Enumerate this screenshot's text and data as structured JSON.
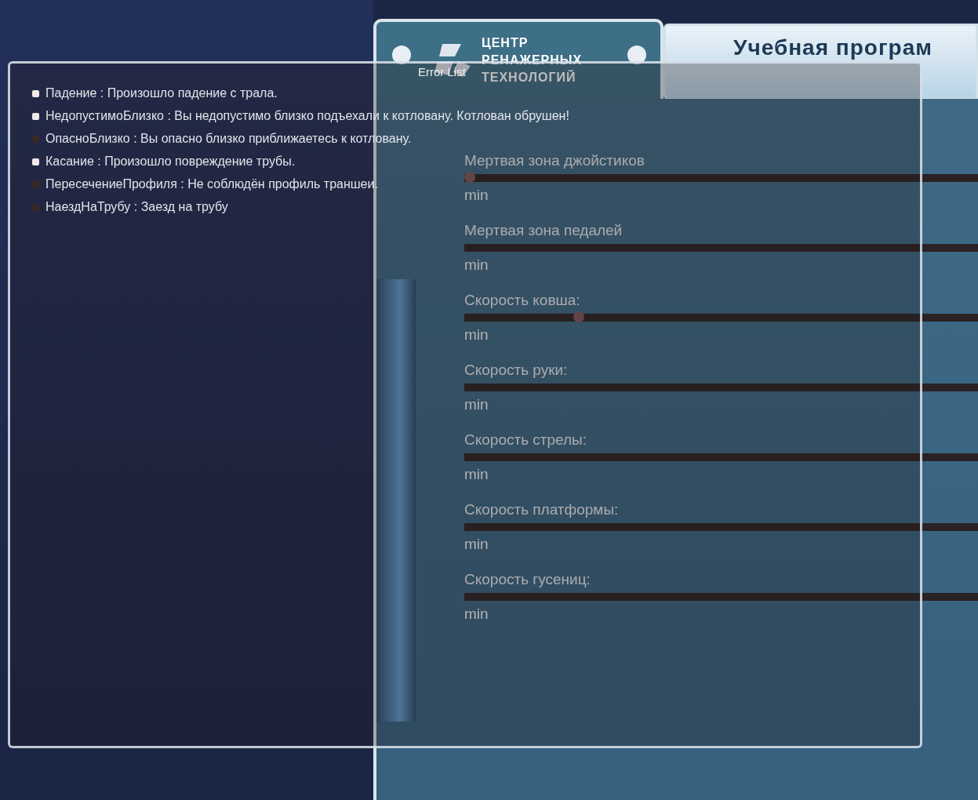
{
  "app": {
    "logo": {
      "lines": [
        "ЦЕНТР",
        "РЕНАЖЕРНЫХ",
        "ТЕХНОЛОГИЙ"
      ]
    },
    "title": "Учебная програм"
  },
  "settings": [
    {
      "label": "Мертвая зона джойстиков",
      "level": 0.0,
      "min_label": "min"
    },
    {
      "label": "Мертвая зона педалей",
      "min_label": "min"
    },
    {
      "label": "Скорость ковша:",
      "level": 0.2,
      "min_label": "min"
    },
    {
      "label": "Скорость руки:",
      "min_label": "min"
    },
    {
      "label": "Скорость стрелы:",
      "min_label": "min"
    },
    {
      "label": "Скорость платформы:",
      "min_label": "min"
    },
    {
      "label": "Скорость гусениц:",
      "min_label": "min"
    }
  ],
  "error_list": {
    "title": "Error List",
    "items": [
      {
        "text": "Падение : Произошло падение с трала.",
        "active": true
      },
      {
        "text": "НедопустимоБлизко : Вы недопустимо близко подъехали к котловану. Котлован обрушен!",
        "active": true
      },
      {
        "text": "ОпасноБлизко : Вы опасно близко приближаетесь к котловану.",
        "active": false
      },
      {
        "text": "Касание : Произошло повреждение трубы.",
        "active": true
      },
      {
        "text": "ПересечениеПрофиля : Не соблюдён профиль траншеи.",
        "active": false
      },
      {
        "text": "НаездНаТрубу : Заезд на трубу",
        "active": false
      }
    ]
  }
}
